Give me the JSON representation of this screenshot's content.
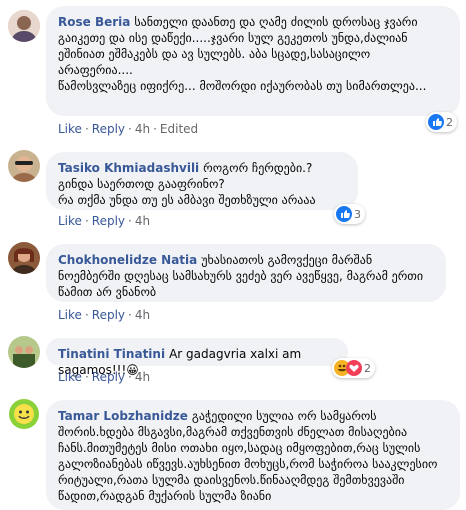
{
  "comments": [
    {
      "author": "Rose Beria",
      "text": "სანთელი დაანთე და ღამე ძილის დროსაც ჯვარი გაიკეთე და ისე დაწექი.....ჯვარი სულ გეკეთოს უნდა,ძალიან ეშინიათ ეშმაკებს და ავ სულებს. აბა სცადე,სასაცილო არაფერია....\nწამოსვლაზეც იფიქრე... მოშორდი იქაურობას თუ სიმართლეა...",
      "like": "Like",
      "reply": "Reply",
      "time": "4h",
      "edited": "Edited",
      "reaction_count": "2"
    },
    {
      "author": "Tasiko Khmiadashvili",
      "text": "როგორ ჩერდები.?\nგინდა საერთოდ გააფრინო?\nრა თქმა უნდა თუ ეს ამბავი შეთხზული არააა",
      "like": "Like",
      "reply": "Reply",
      "time": "4h",
      "reaction_count": "3"
    },
    {
      "author": "Chokhonelidze Natia",
      "text": "უხასიათოს გამოვქეცი მარშან ნოემბერში დღესაც სამსახურს ვეძებ ვერ ავეწყვე, მაგრამ ერთი წამით არ ვნანობ",
      "like": "Like",
      "reply": "Reply",
      "time": "4h"
    },
    {
      "author": "Tinatini Tinatini",
      "text": "Ar gadagvria xalxi am sagamos!!!",
      "emoji": "😀",
      "like": "Like",
      "reply": "Reply",
      "time": "4h",
      "reaction_count": "2"
    },
    {
      "author": "Tamar Lobzhanidze",
      "text": "გაჭედილი სულია ორ სამყაროს შორის.ხდება მსგავსი,მაგრამ თქვენთვის ძნელათ მისაღებია ჩანს.მითუმეტეს მისი ოთახი იყო,სადაც იმყოფებით,რაც სულის გალოზიანებას იწვევს.აუხსენით მოხუცს,რომ საჭიროა სააკლესიო რიტუალი,რათა სულმა დაისვენოს.წინააღმდეგ შემთხვევაში წადით,რადგან მუქარის სულმა ზიანი"
    }
  ]
}
